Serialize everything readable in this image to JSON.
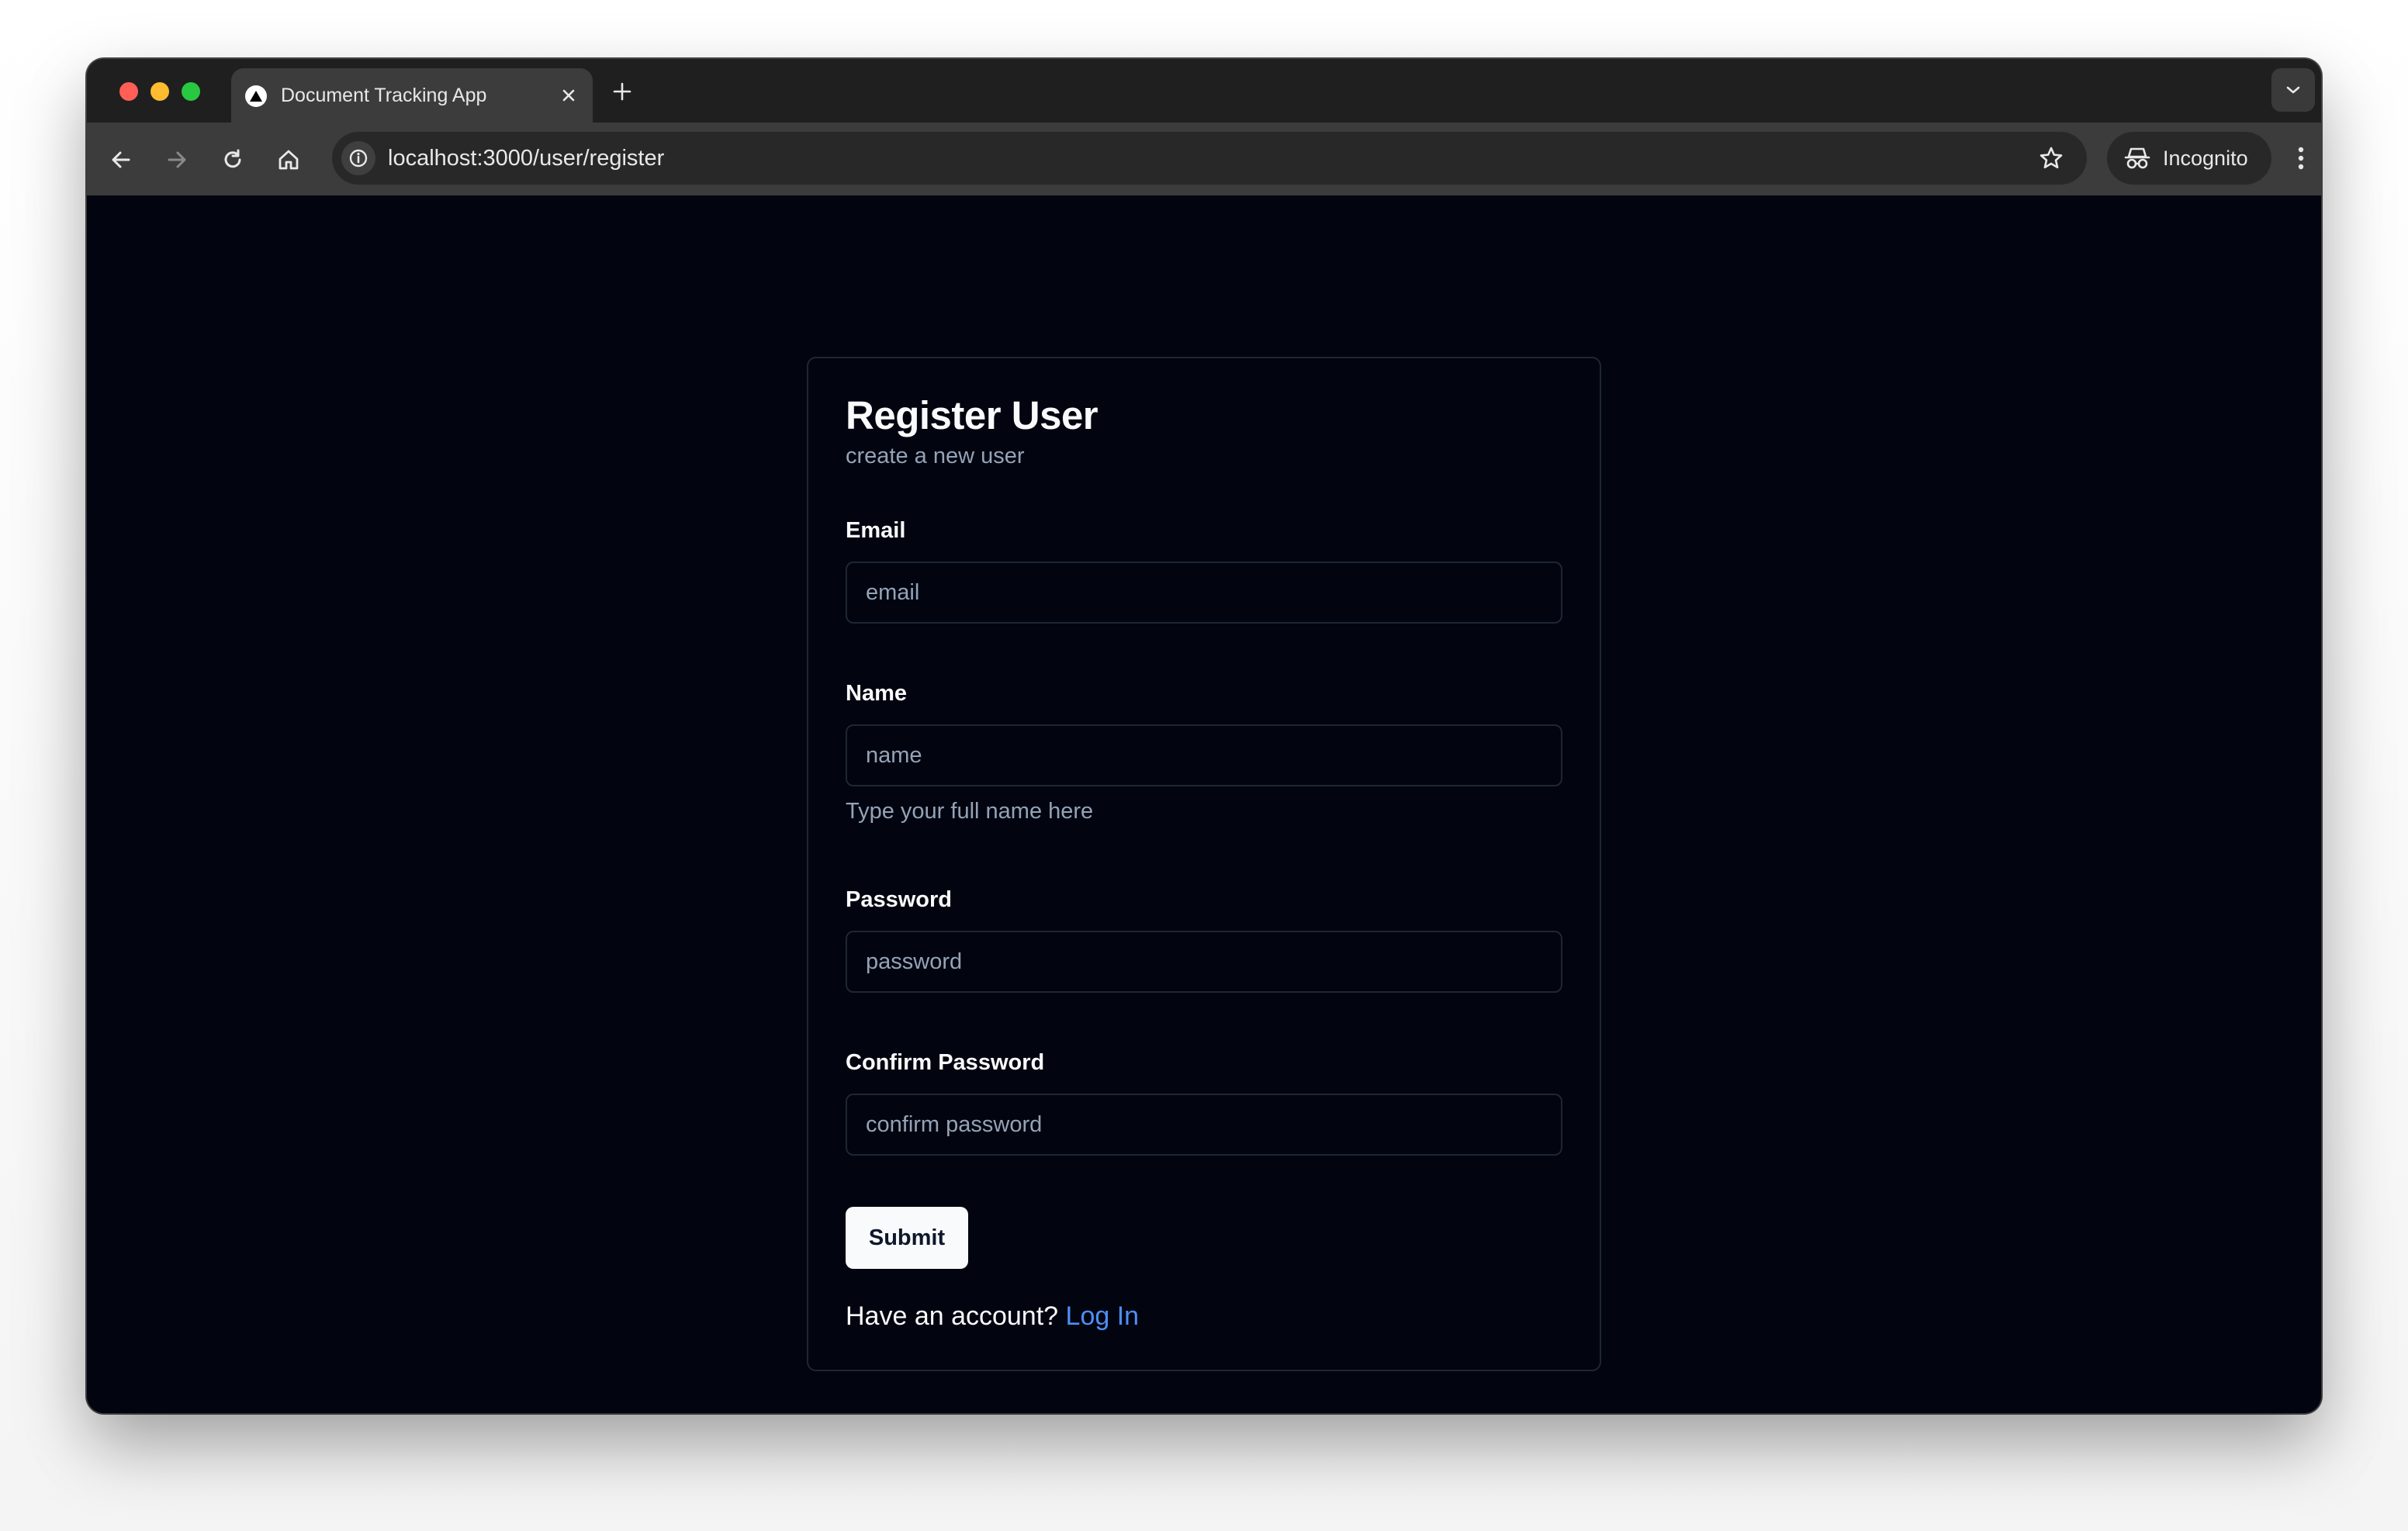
{
  "browser": {
    "tab_title": "Document Tracking App",
    "url": "localhost:3000/user/register",
    "incognito_label": "Incognito",
    "icons": {
      "favicon": "triangle-logo-icon",
      "tab_close": "close-icon",
      "new_tab": "plus-icon",
      "tab_list": "chevron-down-icon",
      "back": "arrow-left-icon",
      "forward": "arrow-right-icon",
      "reload": "reload-icon",
      "home": "home-icon",
      "site_info": "info-icon",
      "bookmark": "star-icon",
      "incognito": "incognito-icon",
      "menu": "kebab-menu-icon"
    }
  },
  "form": {
    "title": "Register User",
    "subtitle": "create a new user",
    "fields": [
      {
        "label": "Email",
        "placeholder": "email",
        "value": ""
      },
      {
        "label": "Name",
        "placeholder": "name",
        "value": "",
        "hint": "Type your full name here"
      },
      {
        "label": "Password",
        "placeholder": "password",
        "value": ""
      },
      {
        "label": "Confirm Password",
        "placeholder": "confirm password",
        "value": ""
      }
    ],
    "submit_label": "Submit",
    "footer_text": "Have an account?",
    "login_link": "Log In"
  },
  "colors": {
    "page_background": "#02050f",
    "card_border": "#1e2636",
    "primary_text": "#f8fafc",
    "muted_text": "#94a3b8",
    "link": "#4e8ef7",
    "button_bg": "#f8fafc"
  }
}
